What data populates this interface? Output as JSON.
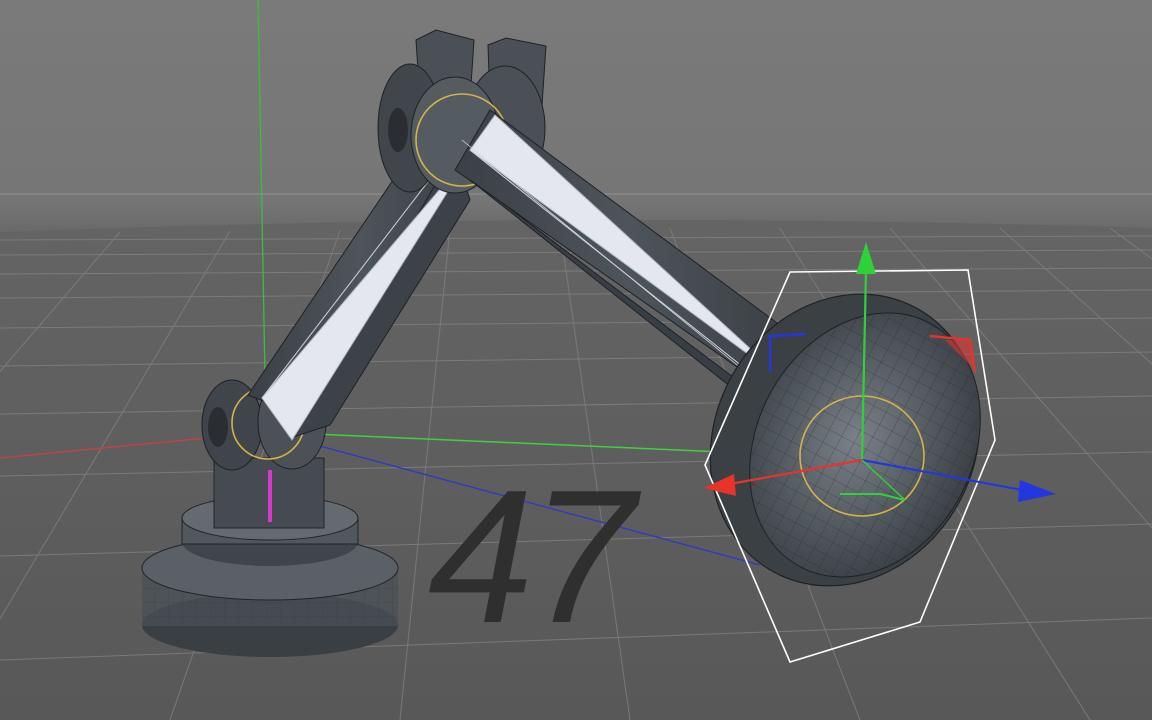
{
  "viewport": {
    "frame_label": "47"
  },
  "colors": {
    "background_upper": "#7a7a7a",
    "floor": "#5e5e5e",
    "grid_line": "#8a8a8a",
    "mesh_fill": "#4b5156",
    "mesh_wire": "#1e2226",
    "bone_fill": "#e4e8ee",
    "axis_x": "#e8332b",
    "axis_y": "#2fd13a",
    "axis_z": "#2337e0",
    "ik_ring": "#d7b24a",
    "selection_box": "#ffffff"
  },
  "objects": [
    {
      "name": "base",
      "icon": "cylinder-icon"
    },
    {
      "name": "lower-arm",
      "icon": "bone-icon"
    },
    {
      "name": "upper-arm",
      "icon": "bone-icon"
    },
    {
      "name": "lamp-head",
      "icon": "disc-icon"
    },
    {
      "name": "move-gizmo",
      "icon": "axis-arrows-icon"
    }
  ]
}
